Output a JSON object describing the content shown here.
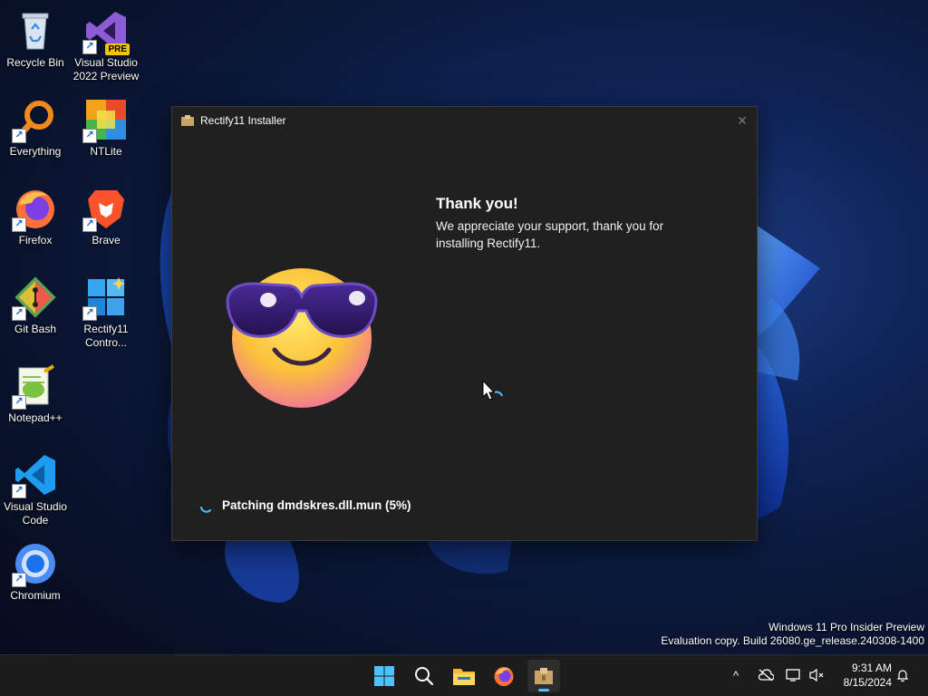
{
  "desktop": {
    "icons": [
      {
        "label": "Recycle Bin"
      },
      {
        "label": "Visual Studio 2022 Preview",
        "badge": "PRE"
      },
      {
        "label": "Everything"
      },
      {
        "label": "NTLite"
      },
      {
        "label": "Firefox"
      },
      {
        "label": "Brave"
      },
      {
        "label": "Git Bash"
      },
      {
        "label": "Rectify11 Contro..."
      },
      {
        "label": "Notepad++"
      },
      {
        "label": "Visual Studio Code"
      },
      {
        "label": "Chromium"
      }
    ]
  },
  "installer": {
    "title": "Rectify11 Installer",
    "close_glyph": "✕",
    "heading": "Thank you!",
    "message": "We appreciate your support, thank you for installing Rectify11.",
    "status": "Patching dmdskres.dll.mun (5%)",
    "progress_percent": 5
  },
  "watermark": {
    "line1": "Windows 11 Pro Insider Preview",
    "line2": "Evaluation copy. Build 26080.ge_release.240308-1400"
  },
  "taskbar": {
    "apps": [
      "start-icon",
      "search-icon",
      "file-explorer-icon",
      "firefox-icon",
      "installer-icon"
    ],
    "active_app": "installer-icon",
    "tray": {
      "chevron": "^"
    },
    "clock": {
      "time": "9:31 AM",
      "date": "8/15/2024"
    }
  },
  "colors": {
    "accent": "#4cc2ff",
    "window_bg": "#202020",
    "taskbar_bg": "#1c1c1c"
  }
}
